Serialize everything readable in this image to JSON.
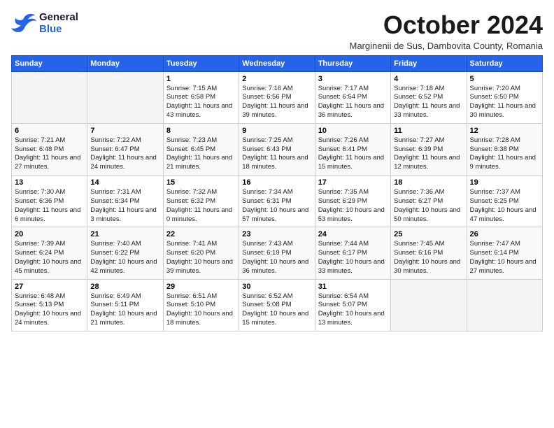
{
  "header": {
    "logo_line1": "General",
    "logo_line2": "Blue",
    "month_title": "October 2024",
    "location": "Marginenii de Sus, Dambovita County, Romania"
  },
  "weekdays": [
    "Sunday",
    "Monday",
    "Tuesday",
    "Wednesday",
    "Thursday",
    "Friday",
    "Saturday"
  ],
  "weeks": [
    [
      {
        "day": "",
        "empty": true
      },
      {
        "day": "",
        "empty": true
      },
      {
        "day": "1",
        "line1": "Sunrise: 7:15 AM",
        "line2": "Sunset: 6:58 PM",
        "line3": "Daylight: 11 hours and 43 minutes."
      },
      {
        "day": "2",
        "line1": "Sunrise: 7:16 AM",
        "line2": "Sunset: 6:56 PM",
        "line3": "Daylight: 11 hours and 39 minutes."
      },
      {
        "day": "3",
        "line1": "Sunrise: 7:17 AM",
        "line2": "Sunset: 6:54 PM",
        "line3": "Daylight: 11 hours and 36 minutes."
      },
      {
        "day": "4",
        "line1": "Sunrise: 7:18 AM",
        "line2": "Sunset: 6:52 PM",
        "line3": "Daylight: 11 hours and 33 minutes."
      },
      {
        "day": "5",
        "line1": "Sunrise: 7:20 AM",
        "line2": "Sunset: 6:50 PM",
        "line3": "Daylight: 11 hours and 30 minutes."
      }
    ],
    [
      {
        "day": "6",
        "line1": "Sunrise: 7:21 AM",
        "line2": "Sunset: 6:48 PM",
        "line3": "Daylight: 11 hours and 27 minutes."
      },
      {
        "day": "7",
        "line1": "Sunrise: 7:22 AM",
        "line2": "Sunset: 6:47 PM",
        "line3": "Daylight: 11 hours and 24 minutes."
      },
      {
        "day": "8",
        "line1": "Sunrise: 7:23 AM",
        "line2": "Sunset: 6:45 PM",
        "line3": "Daylight: 11 hours and 21 minutes."
      },
      {
        "day": "9",
        "line1": "Sunrise: 7:25 AM",
        "line2": "Sunset: 6:43 PM",
        "line3": "Daylight: 11 hours and 18 minutes."
      },
      {
        "day": "10",
        "line1": "Sunrise: 7:26 AM",
        "line2": "Sunset: 6:41 PM",
        "line3": "Daylight: 11 hours and 15 minutes."
      },
      {
        "day": "11",
        "line1": "Sunrise: 7:27 AM",
        "line2": "Sunset: 6:39 PM",
        "line3": "Daylight: 11 hours and 12 minutes."
      },
      {
        "day": "12",
        "line1": "Sunrise: 7:28 AM",
        "line2": "Sunset: 6:38 PM",
        "line3": "Daylight: 11 hours and 9 minutes."
      }
    ],
    [
      {
        "day": "13",
        "line1": "Sunrise: 7:30 AM",
        "line2": "Sunset: 6:36 PM",
        "line3": "Daylight: 11 hours and 6 minutes."
      },
      {
        "day": "14",
        "line1": "Sunrise: 7:31 AM",
        "line2": "Sunset: 6:34 PM",
        "line3": "Daylight: 11 hours and 3 minutes."
      },
      {
        "day": "15",
        "line1": "Sunrise: 7:32 AM",
        "line2": "Sunset: 6:32 PM",
        "line3": "Daylight: 11 hours and 0 minutes."
      },
      {
        "day": "16",
        "line1": "Sunrise: 7:34 AM",
        "line2": "Sunset: 6:31 PM",
        "line3": "Daylight: 10 hours and 57 minutes."
      },
      {
        "day": "17",
        "line1": "Sunrise: 7:35 AM",
        "line2": "Sunset: 6:29 PM",
        "line3": "Daylight: 10 hours and 53 minutes."
      },
      {
        "day": "18",
        "line1": "Sunrise: 7:36 AM",
        "line2": "Sunset: 6:27 PM",
        "line3": "Daylight: 10 hours and 50 minutes."
      },
      {
        "day": "19",
        "line1": "Sunrise: 7:37 AM",
        "line2": "Sunset: 6:25 PM",
        "line3": "Daylight: 10 hours and 47 minutes."
      }
    ],
    [
      {
        "day": "20",
        "line1": "Sunrise: 7:39 AM",
        "line2": "Sunset: 6:24 PM",
        "line3": "Daylight: 10 hours and 45 minutes."
      },
      {
        "day": "21",
        "line1": "Sunrise: 7:40 AM",
        "line2": "Sunset: 6:22 PM",
        "line3": "Daylight: 10 hours and 42 minutes."
      },
      {
        "day": "22",
        "line1": "Sunrise: 7:41 AM",
        "line2": "Sunset: 6:20 PM",
        "line3": "Daylight: 10 hours and 39 minutes."
      },
      {
        "day": "23",
        "line1": "Sunrise: 7:43 AM",
        "line2": "Sunset: 6:19 PM",
        "line3": "Daylight: 10 hours and 36 minutes."
      },
      {
        "day": "24",
        "line1": "Sunrise: 7:44 AM",
        "line2": "Sunset: 6:17 PM",
        "line3": "Daylight: 10 hours and 33 minutes."
      },
      {
        "day": "25",
        "line1": "Sunrise: 7:45 AM",
        "line2": "Sunset: 6:16 PM",
        "line3": "Daylight: 10 hours and 30 minutes."
      },
      {
        "day": "26",
        "line1": "Sunrise: 7:47 AM",
        "line2": "Sunset: 6:14 PM",
        "line3": "Daylight: 10 hours and 27 minutes."
      }
    ],
    [
      {
        "day": "27",
        "line1": "Sunrise: 6:48 AM",
        "line2": "Sunset: 5:13 PM",
        "line3": "Daylight: 10 hours and 24 minutes."
      },
      {
        "day": "28",
        "line1": "Sunrise: 6:49 AM",
        "line2": "Sunset: 5:11 PM",
        "line3": "Daylight: 10 hours and 21 minutes."
      },
      {
        "day": "29",
        "line1": "Sunrise: 6:51 AM",
        "line2": "Sunset: 5:10 PM",
        "line3": "Daylight: 10 hours and 18 minutes."
      },
      {
        "day": "30",
        "line1": "Sunrise: 6:52 AM",
        "line2": "Sunset: 5:08 PM",
        "line3": "Daylight: 10 hours and 15 minutes."
      },
      {
        "day": "31",
        "line1": "Sunrise: 6:54 AM",
        "line2": "Sunset: 5:07 PM",
        "line3": "Daylight: 10 hours and 13 minutes."
      },
      {
        "day": "",
        "empty": true
      },
      {
        "day": "",
        "empty": true
      }
    ]
  ]
}
